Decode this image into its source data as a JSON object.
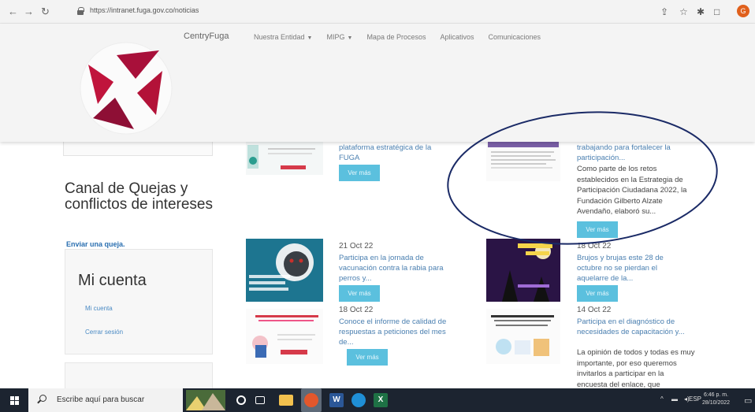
{
  "browser": {
    "url": "https://intranet.fuga.gov.co/noticias"
  },
  "header": {
    "brand": "CentryFuga",
    "nav": [
      {
        "label": "Nuestra Entidad",
        "caret": true
      },
      {
        "label": "MIPG",
        "caret": true
      },
      {
        "label": "Mapa de Procesos",
        "caret": false
      },
      {
        "label": "Aplicativos",
        "caret": false
      },
      {
        "label": "Comunicaciones",
        "caret": false
      }
    ]
  },
  "sidebar": {
    "quejas_title": "Canal de Quejas y conflictos de intereses",
    "quejas_link": "Enviar una queja.",
    "cuenta_title": "Mi cuenta",
    "cuenta_links": [
      "Mi cuenta",
      "Cerrar sesión"
    ]
  },
  "news": {
    "card1": {
      "text": "plataforma estratégica de la FUGA",
      "button": "Ver más"
    },
    "card2": {
      "title": "trabajando para fortalecer la participación...",
      "body": "Como parte de los retos establecidos en la Estrategia de Participación Ciudadana 2022, la Fundación Gilberto Alzate Avendaño, elaboró su...",
      "button": "Ver más"
    },
    "card3": {
      "date": "21 Oct 22",
      "text": "Participa en la jornada de vacunación contra la rabia para perros y...",
      "button": "Ver más"
    },
    "card4": {
      "date": "18 Oct 22",
      "text": "Brujos y brujas este 28 de octubre no se pierdan el aquelarre de la...",
      "button": "Ver más"
    },
    "card5": {
      "date": "18 Oct 22",
      "text": "Conoce el informe de calidad de respuestas a peticiones del mes de...",
      "button": "Ver más"
    },
    "card6": {
      "date": "14 Oct 22",
      "text": "Participa en el diagnóstico de necesidades de capacitación y...",
      "body": "La opinión de todos y todas es muy importante, por eso queremos invitarlos a participar en la encuesta del enlace, que"
    }
  },
  "taskbar": {
    "search_placeholder": "Escribe aquí para buscar",
    "lang": "ESP",
    "time": "6:46 p. m.",
    "date": "28/10/2022"
  },
  "colors": {
    "brand_red": "#c0143c",
    "button_blue": "#5bc0de",
    "link_blue": "#4a7fb0",
    "annotation_circle": "#1a2a66"
  }
}
